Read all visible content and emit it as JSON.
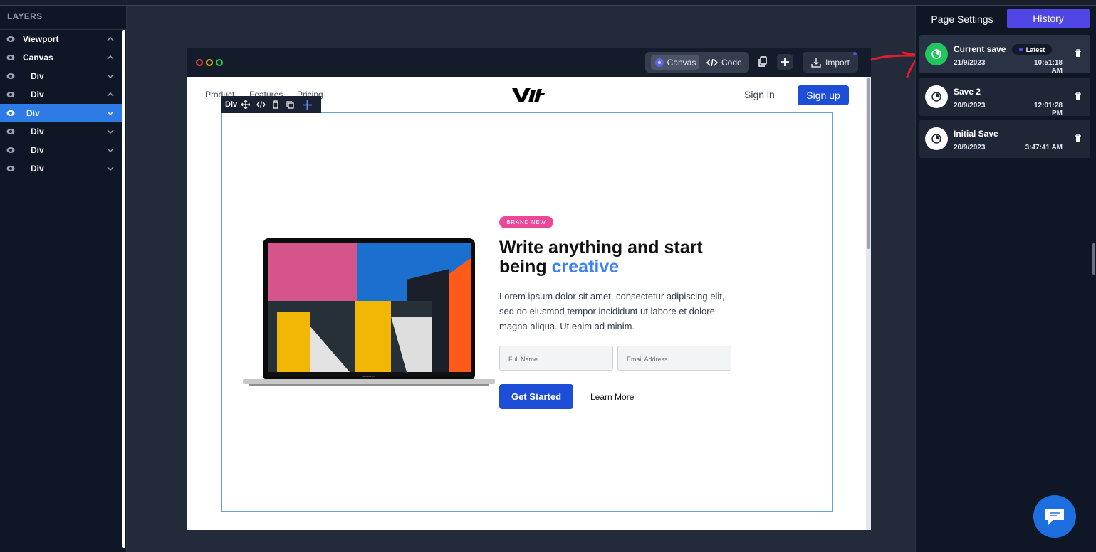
{
  "layers": {
    "title": "LAYERS",
    "items": [
      {
        "label": "Viewport",
        "indent": 0,
        "expanded": true
      },
      {
        "label": "Canvas",
        "indent": 0,
        "expanded": true
      },
      {
        "label": "Div",
        "indent": 1,
        "expanded": false
      },
      {
        "label": "Div",
        "indent": 1,
        "expanded": true
      },
      {
        "label": "Div",
        "indent": 1,
        "expanded": false,
        "selected": true
      },
      {
        "label": "Div",
        "indent": 1,
        "expanded": false
      },
      {
        "label": "Div",
        "indent": 1,
        "expanded": false
      },
      {
        "label": "Div",
        "indent": 1,
        "expanded": false
      }
    ]
  },
  "canvas_toolbar": {
    "canvas_label": "Canvas",
    "code_label": "Code",
    "import_label": "Import"
  },
  "site": {
    "nav": {
      "links": [
        "Product",
        "Features",
        "Pricing"
      ],
      "signin": "Sign in",
      "signup": "Sign up"
    },
    "badge": "BRAND NEW",
    "title_line1": "Write anything and start",
    "title_line2_plain": "being ",
    "title_line2_accent": "creative",
    "description": "Lorem ipsum dolor sit amet, consectetur adipiscing elit, sed do eiusmod tempor incididunt ut labore et dolore magna aliqua. Ut enim ad minim.",
    "fullname_placeholder": "Full Name",
    "email_placeholder": "Email Address",
    "get_started": "Get Started",
    "learn_more": "Learn More",
    "laptop_label": "MacBook Pro"
  },
  "selection": {
    "element_label": "Div"
  },
  "right_panel": {
    "tabs": {
      "page_settings": "Page Settings",
      "history": "History"
    },
    "saves": [
      {
        "name": "Current save",
        "date": "21/9/2023",
        "time": "10:51:18 AM",
        "latest_badge": "Latest",
        "current": true
      },
      {
        "name": "Save 2",
        "date": "20/9/2023",
        "time": "12:01:28 PM"
      },
      {
        "name": "Initial Save",
        "date": "20/9/2023",
        "time": "3:47:41 AM"
      }
    ]
  },
  "colors": {
    "accent": "#4f46e5",
    "selected_layer": "#2f7be5",
    "primary_button": "#1d4ed8",
    "badge_pink": "#ec4899",
    "current_save_green": "#22c55e"
  }
}
